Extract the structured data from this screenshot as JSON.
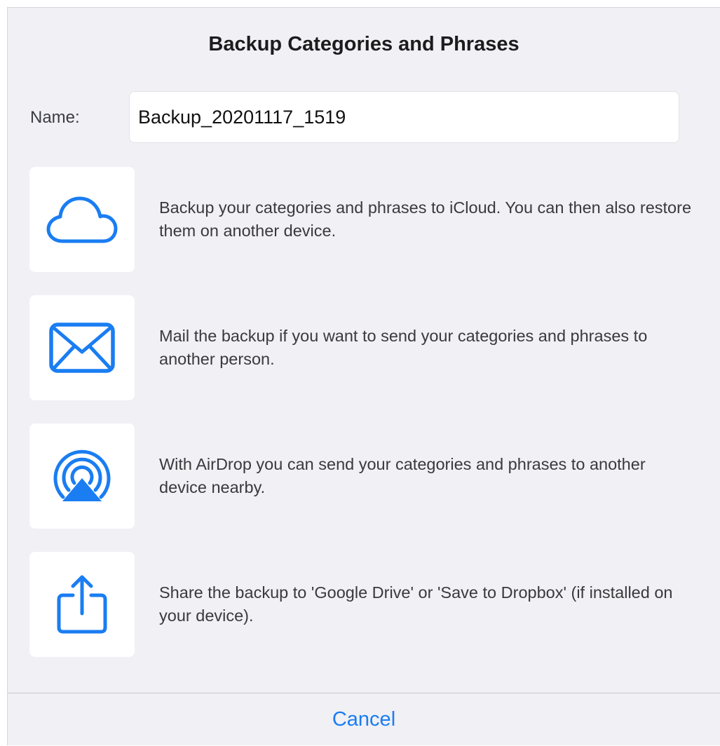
{
  "dialog": {
    "title": "Backup Categories and Phrases",
    "accent_color": "#1a7df2"
  },
  "name_field": {
    "label": "Name:",
    "value": "Backup_20201117_1519"
  },
  "options": [
    {
      "icon": "cloud-icon",
      "description": "Backup your categories and phrases to iCloud. You can then also restore them on another device."
    },
    {
      "icon": "mail-icon",
      "description": "Mail the backup if you want to send your categories and phrases to another person."
    },
    {
      "icon": "airdrop-icon",
      "description": "With AirDrop you can send your categories and phrases to another device nearby."
    },
    {
      "icon": "share-icon",
      "description": "Share the backup to 'Google Drive' or 'Save to Dropbox' (if installed on your device)."
    }
  ],
  "footer": {
    "cancel_label": "Cancel"
  }
}
